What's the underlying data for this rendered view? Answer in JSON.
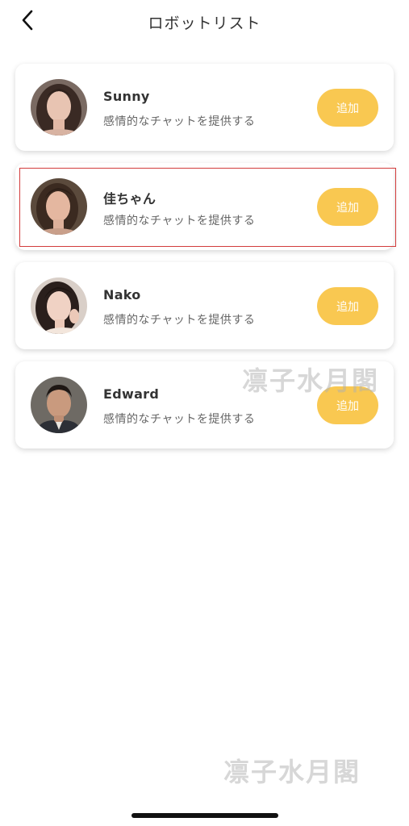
{
  "nav": {
    "title": "ロボットリスト",
    "back_icon": "chevron-left-icon"
  },
  "robots": [
    {
      "name": "Sunny",
      "description": "感情的なチャットを提供する",
      "button_label": "追加"
    },
    {
      "name": "佳ちゃん",
      "description": "感情的なチャットを提供する",
      "button_label": "追加"
    },
    {
      "name": "Nako",
      "description": "感情的なチャットを提供する",
      "button_label": "追加"
    },
    {
      "name": "Edward",
      "description": "感情的なチャットを提供する",
      "button_label": "追加"
    }
  ],
  "watermark": {
    "text": "凛子水月閣"
  },
  "colors": {
    "accent": "#f9c851",
    "highlight": "#d23b3b",
    "title_text": "#333333",
    "desc_text": "#666666"
  }
}
